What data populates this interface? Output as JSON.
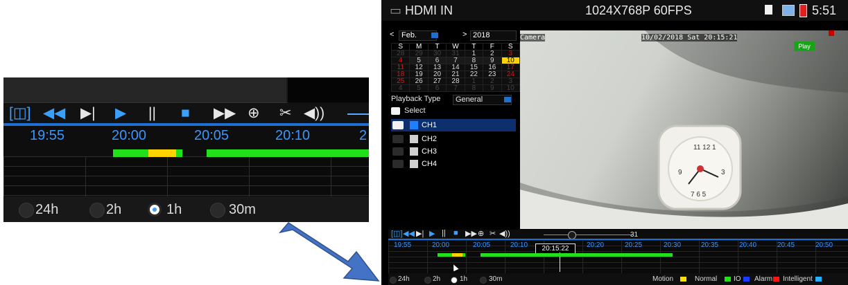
{
  "zoom": {
    "controls": [
      "[◫]",
      "◀◀",
      "▶|",
      "▶",
      "||",
      "■",
      "▶▶",
      "⊕",
      "✂",
      "◀))"
    ],
    "times": [
      "19:55",
      "20:00",
      "20:05",
      "20:10",
      "2"
    ],
    "radios": [
      "24h",
      "2h",
      "1h",
      "30m"
    ],
    "selected_radio": "1h"
  },
  "topbar": {
    "source": "HDMI IN",
    "resolution": "1024X768P 60FPS",
    "clock": "5:51"
  },
  "calendar": {
    "month": "Feb.",
    "year": "2018",
    "weekdays": [
      "S",
      "M",
      "T",
      "W",
      "T",
      "F",
      "S"
    ],
    "rows": [
      [
        "28",
        "29",
        "30",
        "31",
        "1",
        "2",
        "3"
      ],
      [
        "4",
        "5",
        "6",
        "7",
        "8",
        "9",
        "10"
      ],
      [
        "11",
        "12",
        "13",
        "14",
        "15",
        "16",
        "17"
      ],
      [
        "18",
        "19",
        "20",
        "21",
        "22",
        "23",
        "24"
      ],
      [
        "25",
        "26",
        "27",
        "28",
        "1",
        "2",
        "3"
      ],
      [
        "4",
        "5",
        "6",
        "7",
        "8",
        "9",
        "10"
      ]
    ]
  },
  "playback": {
    "type_label": "Playback Type",
    "type_value": "General",
    "select_label": "Select",
    "channels": [
      {
        "label": "CH1",
        "checked": true
      },
      {
        "label": "CH2",
        "checked": false
      },
      {
        "label": "CH3",
        "checked": false
      },
      {
        "label": "CH4",
        "checked": false
      }
    ]
  },
  "video": {
    "camera_label": "Camera",
    "timestamp": "10/02/2018 Sat 20:15:21",
    "play_label": "Play"
  },
  "timeline": {
    "volume_value": "31",
    "current_time": "20:15:22",
    "times": [
      "19:55",
      "20:00",
      "20:05",
      "20:10",
      "20:20",
      "20:25",
      "20:30",
      "20:35",
      "20:40",
      "20:45",
      "20:50"
    ],
    "radios": [
      "24h",
      "2h",
      "1h",
      "30m"
    ],
    "legend": [
      {
        "label": "Motion",
        "color": "#ffe000"
      },
      {
        "label": "Normal",
        "color": "#22e01a"
      },
      {
        "label": "IO",
        "color": "#1a3cff"
      },
      {
        "label": "Alarm",
        "color": "#ff1414"
      },
      {
        "label": "Intelligent",
        "color": "#22b0ff"
      }
    ]
  },
  "colors": {
    "accent_blue": "#3aa0ff",
    "normal_green": "#22e01a",
    "motion_yellow": "#ffe000"
  }
}
